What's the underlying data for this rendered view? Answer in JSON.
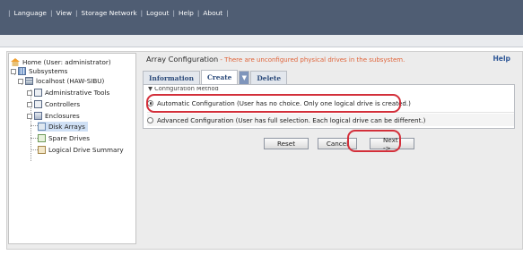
{
  "topnav": {
    "items": [
      "Language",
      "View",
      "Storage Network",
      "Logout",
      "Help",
      "About"
    ]
  },
  "tree": {
    "home": "Home (User: administrator)",
    "subsystems": "Subsystems",
    "host": "localhost (HAW-SIBU)",
    "admin_tools": "Administrative Tools",
    "controllers": "Controllers",
    "enclosures": "Enclosures",
    "disk_arrays": "Disk Arrays",
    "spare_drives": "Spare Drives",
    "logical_drive_summary": "Logical Drive Summary"
  },
  "main": {
    "title": "Array Configuration",
    "warning": " - There are unconfigured physical drives in the subsystem.",
    "help": "Help",
    "tabs": {
      "information": "Information",
      "create": "Create",
      "create_arrow": "▼",
      "delete": "Delete"
    },
    "section_title": "▼ Configuration Method",
    "options": {
      "automatic": "Automatic Configuration (User has no choice. Only one logical drive is created.)",
      "advanced": "Advanced Configuration (User has full selection. Each logical drive can be different.)"
    },
    "buttons": {
      "reset": "Reset",
      "cancel": "Cancel",
      "next": "Next ->"
    }
  },
  "colors": {
    "topbar": "#4f5d73",
    "callout": "#d32f3a",
    "warning_text": "#e0643a",
    "tab_text": "#2b4a7a"
  }
}
